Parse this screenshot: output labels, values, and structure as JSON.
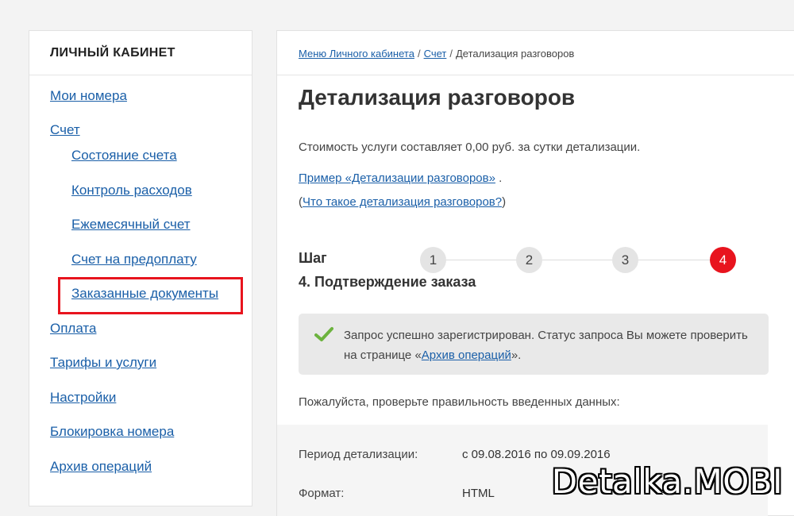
{
  "sidebar": {
    "title": "ЛИЧНЫЙ КАБИНЕТ",
    "items": [
      {
        "label": "Мои номера"
      },
      {
        "label": "Счет"
      },
      {
        "label": "Состояние счета"
      },
      {
        "label": "Контроль расходов"
      },
      {
        "label": "Ежемесячный счет"
      },
      {
        "label": "Счет на предоплату"
      },
      {
        "label": "Заказанные документы"
      },
      {
        "label": "Оплата"
      },
      {
        "label": "Тарифы и услуги"
      },
      {
        "label": "Настройки"
      },
      {
        "label": "Блокировка номера"
      },
      {
        "label": "Архив операций"
      }
    ]
  },
  "breadcrumb": {
    "items": [
      "Меню Личного кабинета",
      "Счет"
    ],
    "separator": "/",
    "current": "Детализация разговоров"
  },
  "main": {
    "title": "Детализация разговоров",
    "cost_text": "Стоимость услуги составляет 0,00 руб. за сутки детализации.",
    "example_link": "Пример «Детализации разговоров»",
    "example_suffix": " .",
    "whatis_open": "(",
    "whatis_link": "Что такое детализация разговоров?",
    "whatis_close": ")",
    "step_label": "Шаг",
    "step_name": "4. Подтверждение заказа",
    "steps": [
      "1",
      "2",
      "3",
      "4"
    ],
    "success_prefix": "Запрос успешно зарегистрирован. Статус запроса Вы можете проверить на странице «",
    "success_link": "Архив операций",
    "success_suffix": "».",
    "check_text": "Пожалуйста, проверьте правильность введенных данных:",
    "details": [
      {
        "label": "Период детализации:",
        "value": "с 09.08.2016 по 09.09.2016"
      },
      {
        "label": "Формат:",
        "value": "HTML"
      }
    ]
  },
  "watermark": "Detalka.MOBI",
  "colors": {
    "accent": "#e8141e",
    "link": "#1a5fa8",
    "check": "#6cb33e"
  }
}
